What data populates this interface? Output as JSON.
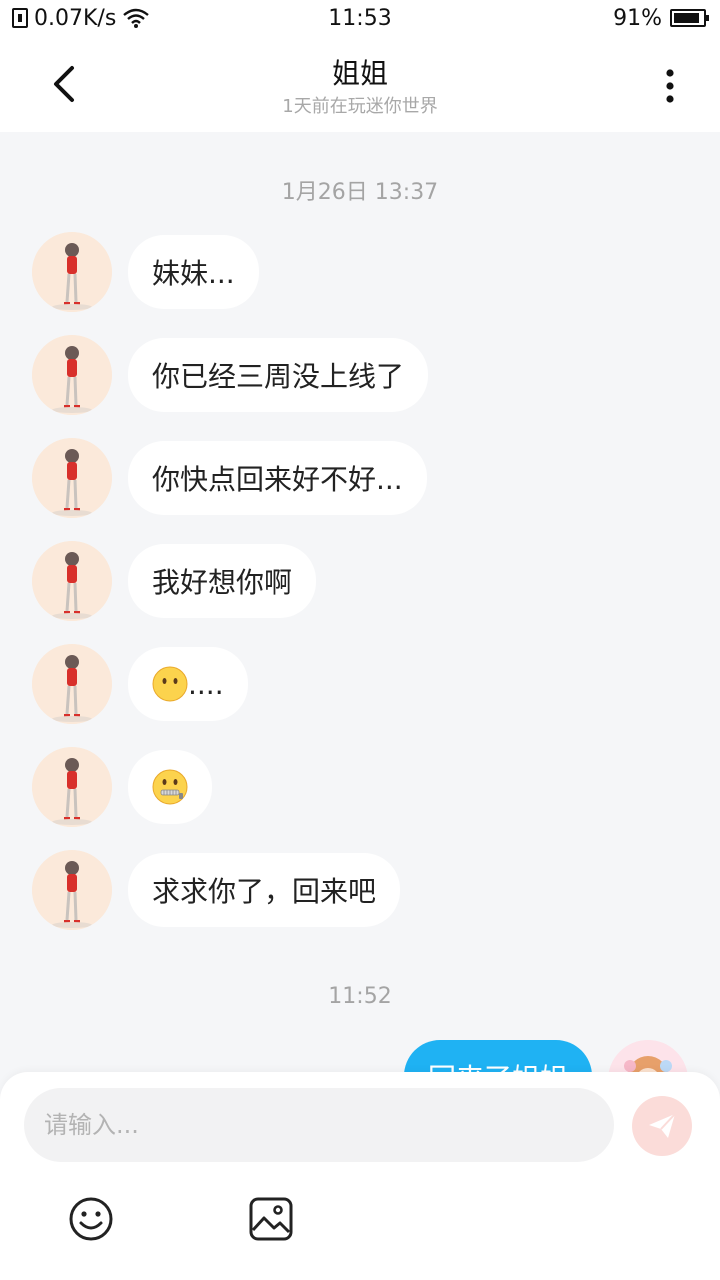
{
  "status_bar": {
    "network_speed": "0.07K/s",
    "time": "11:53",
    "battery": "91%",
    "battery_level": 0.91,
    "icons": [
      "sim-icon",
      "wifi-icon",
      "battery-icon"
    ]
  },
  "header": {
    "title": "姐姐",
    "subtitle": "1天前在玩迷你世界",
    "back_icon": "chevron-left-icon",
    "more_icon": "more-vertical-icon"
  },
  "chat": {
    "groups": [
      {
        "timestamp": "1月26日 13:37",
        "messages": [
          {
            "direction": "in",
            "text": "妹妹..."
          },
          {
            "direction": "in",
            "text": "你已经三周没上线了"
          },
          {
            "direction": "in",
            "text": "你快点回来好不好..."
          },
          {
            "direction": "in",
            "text": "我好想你啊"
          },
          {
            "direction": "in",
            "emoji": "no-mouth-face-emoji",
            "text": "...."
          },
          {
            "direction": "in",
            "emoji": "zipper-mouth-face-emoji",
            "text": ""
          },
          {
            "direction": "in",
            "text": "求求你了，回来吧"
          }
        ]
      },
      {
        "timestamp": "11:52",
        "messages": [
          {
            "direction": "out",
            "text": "回来了姐姐"
          }
        ]
      }
    ]
  },
  "input": {
    "placeholder": "请输入...",
    "value": "",
    "send_icon": "paper-plane-icon",
    "tools": [
      "emoji-icon",
      "image-icon"
    ]
  },
  "colors": {
    "background": "#f5f6f8",
    "bubble_in": "#ffffff",
    "bubble_out": "#1fb2f3",
    "send_button": "#fbdcd9"
  }
}
